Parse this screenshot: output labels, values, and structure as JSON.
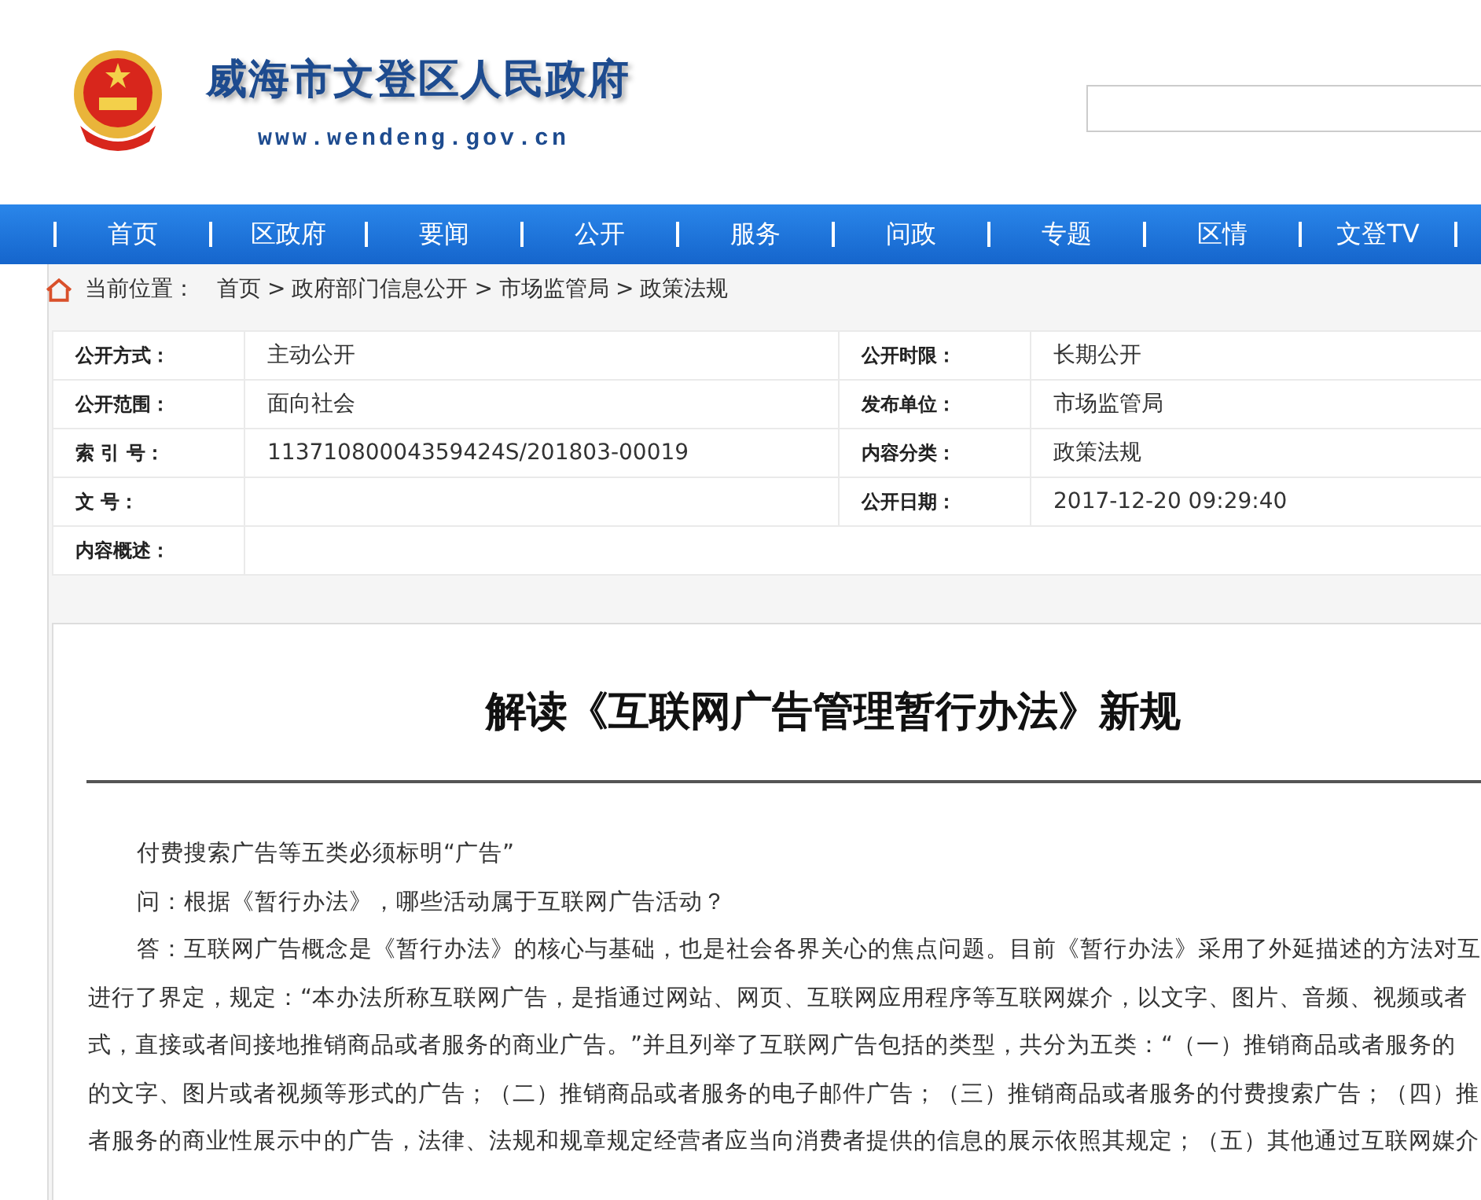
{
  "header": {
    "site_title": "威海市文登区人民政府",
    "site_url": "www.wendeng.gov.cn"
  },
  "nav": [
    {
      "label": "首页"
    },
    {
      "label": "区政府"
    },
    {
      "label": "要闻"
    },
    {
      "label": "公开"
    },
    {
      "label": "服务"
    },
    {
      "label": "问政"
    },
    {
      "label": "专题"
    },
    {
      "label": "区情"
    },
    {
      "label": "文登TV"
    }
  ],
  "breadcrumb": {
    "label": "当前位置：",
    "separator": ">",
    "items": [
      "首页",
      "政府部门信息公开",
      "市场监管局",
      "政策法规"
    ]
  },
  "info_table": {
    "rows": [
      {
        "label_1": "公开方式：",
        "value_1": "主动公开",
        "label_2": "公开时限：",
        "value_2": "长期公开"
      },
      {
        "label_1": "公开范围：",
        "value_1": "面向社会",
        "label_2": "发布单位：",
        "value_2": "市场监管局"
      },
      {
        "label_1": "索 引 号：",
        "value_1": "11371080004359424S/201803-00019",
        "label_2": "内容分类：",
        "value_2": "政策法规"
      },
      {
        "label_1": "文 号：",
        "label_2": "公开日期：",
        "value_2": "2017-12-20 09:29:40"
      },
      {
        "label_1": "内容概述："
      }
    ]
  },
  "article": {
    "title": "解读《互联网广告管理暂行办法》新规",
    "paragraphs": [
      {
        "kind": "indent",
        "text": "付费搜索广告等五类必须标明“广告”"
      },
      {
        "kind": "indent",
        "text": "问：根据《暂行办法》，哪些活动属于互联网广告活动？"
      },
      {
        "kind": "indent",
        "text": "答：互联网广告概念是《暂行办法》的核心与基础，也是社会各界关心的焦点问题。目前《暂行办法》采用了外延描述的方法对互"
      },
      {
        "kind": "line",
        "text": "进行了界定，规定：“本办法所称互联网广告，是指通过网站、网页、互联网应用程序等互联网媒介，以文字、图片、音频、视频或者"
      },
      {
        "kind": "line",
        "text": "式，直接或者间接地推销商品或者服务的商业广告。”并且列举了互联网广告包括的类型，共分为五类：“（一）推销商品或者服务的"
      },
      {
        "kind": "line",
        "text": "的文字、图片或者视频等形式的广告；（二）推销商品或者服务的电子邮件广告；（三）推销商品或者服务的付费搜索广告；（四）推"
      },
      {
        "kind": "line",
        "text": "者服务的商业性展示中的广告，法律、法规和规章规定经营者应当向消费者提供的信息的展示依照其规定；（五）其他通过互联网媒介"
      }
    ]
  }
}
